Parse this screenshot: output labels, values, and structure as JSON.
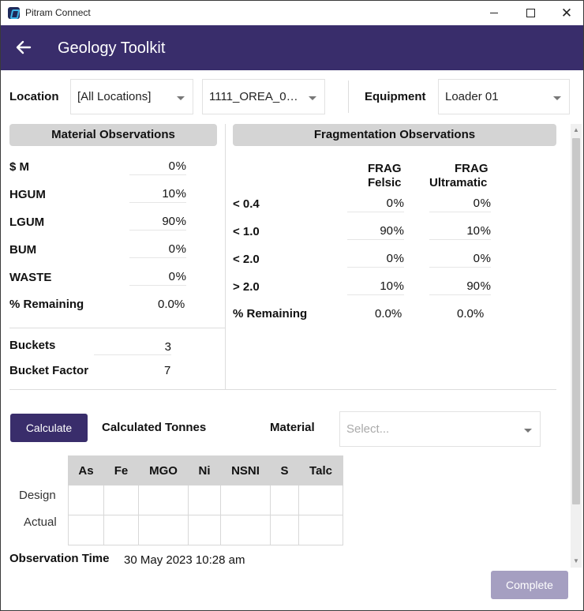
{
  "window": {
    "title": "Pitram Connect",
    "minimize": "—",
    "maximize": "☐",
    "close": "✕"
  },
  "appbar": {
    "title": "Geology Toolkit"
  },
  "filters": {
    "location_label": "Location",
    "location_value": "[All Locations]",
    "sublocation_value": "1111_OREA_0…",
    "equipment_label": "Equipment",
    "equipment_value": "Loader 01"
  },
  "material": {
    "header": "Material Observations",
    "rows": [
      {
        "label": "$ M",
        "value": "0"
      },
      {
        "label": "HGUM",
        "value": "10"
      },
      {
        "label": "LGUM",
        "value": "90"
      },
      {
        "label": "BUM",
        "value": "0"
      },
      {
        "label": "WASTE",
        "value": "0"
      }
    ],
    "remaining_label": "% Remaining",
    "remaining_value": "0.0%",
    "buckets_label": "Buckets",
    "buckets_value": "3",
    "bucket_factor_label": "Bucket Factor",
    "bucket_factor_value": "7"
  },
  "fragmentation": {
    "header": "Fragmentation Observations",
    "col1_line1": "FRAG",
    "col1_line2": "Felsic",
    "col2_line1": "FRAG",
    "col2_line2": "Ultramatic",
    "rows": [
      {
        "label": "< 0.4",
        "felsic": "0",
        "ultramatic": "0"
      },
      {
        "label": "< 1.0",
        "felsic": "90",
        "ultramatic": "10"
      },
      {
        "label": "< 2.0",
        "felsic": "0",
        "ultramatic": "0"
      },
      {
        "label": "> 2.0",
        "felsic": "10",
        "ultramatic": "90"
      }
    ],
    "remaining_label": "% Remaining",
    "remaining_felsic": "0.0%",
    "remaining_ultramatic": "0.0%"
  },
  "percent_sign": "%",
  "calc": {
    "button": "Calculate",
    "tonnes_label": "Calculated Tonnes",
    "material_label": "Material",
    "material_placeholder": "Select..."
  },
  "grid": {
    "columns": [
      "As",
      "Fe",
      "MGO",
      "Ni",
      "NSNI",
      "S",
      "Talc"
    ],
    "rows": [
      "Design",
      "Actual"
    ]
  },
  "observation": {
    "label": "Observation Time",
    "value": "30 May 2023 10:28 am"
  },
  "complete_button": "Complete"
}
